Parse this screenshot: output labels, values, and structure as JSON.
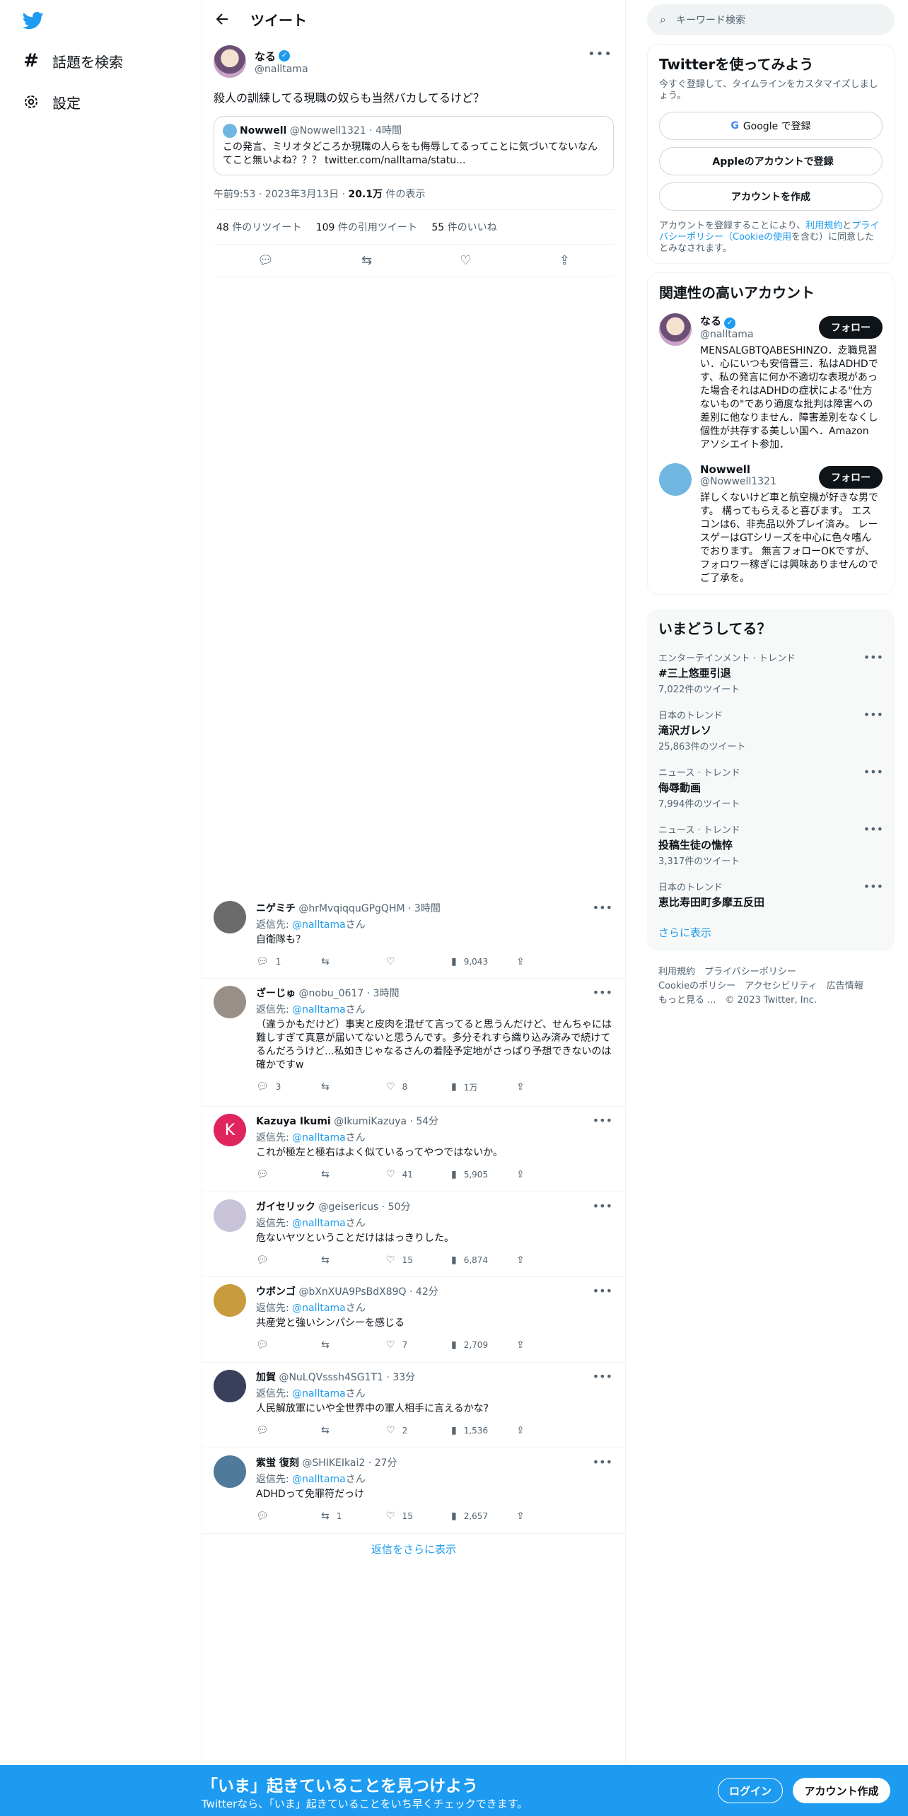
{
  "nav": {
    "explore": "話題を検索",
    "settings": "設定"
  },
  "header": {
    "title": "ツイート"
  },
  "tweet": {
    "name": "なる",
    "handle": "@nalltama",
    "text": "殺人の訓練してる現職の奴らも当然バカしてるけど？",
    "quote": {
      "name": "Nowwell",
      "handle": "@Nowwell1321",
      "time": "4時間",
      "text": "この発言、ミリオタどころか現職の人らをも侮辱してるってことに気づいてないなんてこと無いよね？？？ twitter.com/nalltama/statu..."
    },
    "time": "午前9:53 · 2023年3月13日 · ",
    "views_count": "20.1万",
    "views_label": " 件の表示",
    "retweets_count": "48",
    "retweets_label": " 件のリツイート",
    "quotes_count": "109",
    "quotes_label": " 件の引用ツイート",
    "likes_count": "55",
    "likes_label": " 件のいいね"
  },
  "reply_prefix": "返信先: ",
  "reply_suffix": "さん",
  "reply_target": "@nalltama",
  "replies": [
    {
      "name": "ニゲミチ",
      "handle": "@hrMvqiqquGPgQHM",
      "time": "3時間",
      "text": "自衛隊も？",
      "reply": "1",
      "retweet": "",
      "like": "",
      "views": "9,043",
      "color": "#6b6b6b"
    },
    {
      "name": "ざーじゅ",
      "handle": "@nobu_0617",
      "time": "3時間",
      "text": "（違うかもだけど）事実と皮肉を混ぜて言ってると思うんだけど、せんちゃには難しすぎて真意が届いてないと思うんです。多分それすら織り込み済みで続けてるんだろうけど...私如きじゃなるさんの着陸予定地がさっぱり予想できないのは確かですw",
      "reply": "3",
      "retweet": "",
      "like": "8",
      "views": "1万",
      "color": "#9a8f86"
    },
    {
      "name": "Kazuya Ikumi",
      "handle": "@IkumiKazuya",
      "time": "54分",
      "text": "これが極左と極右はよく似ているってやつではないか。",
      "reply": "",
      "retweet": "",
      "like": "41",
      "views": "5,905",
      "color": "#e0245e",
      "initial": "K"
    },
    {
      "name": "ガイセリック",
      "handle": "@geisericus",
      "time": "50分",
      "text": "危ないヤツということだけははっきりした。",
      "reply": "",
      "retweet": "",
      "like": "15",
      "views": "6,874",
      "color": "#c8c3d9"
    },
    {
      "name": "ウボンゴ",
      "handle": "@bXnXUA9PsBdX89Q",
      "time": "42分",
      "text": "共産党と強いシンパシーを感じる",
      "reply": "",
      "retweet": "",
      "like": "7",
      "views": "2,709",
      "color": "#c89b3c"
    },
    {
      "name": "加賀",
      "handle": "@NuLQVsssh4SG1T1",
      "time": "33分",
      "text": "人民解放軍にいや全世界中の軍人相手に言えるかな?",
      "reply": "",
      "retweet": "",
      "like": "2",
      "views": "1,536",
      "color": "#3a3f5c"
    },
    {
      "name": "紫蛍 復刻",
      "handle": "@SHIKEIkai2",
      "time": "27分",
      "text": "ADHDって免罪符だっけ",
      "reply": "",
      "retweet": "1",
      "like": "15",
      "views": "2,657",
      "color": "#4f7a9a"
    }
  ],
  "show_more_replies": "返信をさらに表示",
  "search": {
    "placeholder": "キーワード検索"
  },
  "signup": {
    "title": "Twitterを使ってみよう",
    "subtitle": "今すぐ登録して、タイムラインをカスタマイズしましょう。",
    "google": "Google で登録",
    "apple": "Appleのアカウントで登録",
    "create": "アカウントを作成",
    "legal_1": "アカウントを登録することにより、",
    "legal_terms": "利用規約",
    "legal_2": "と",
    "legal_privacy": "プライバシーポリシー（Cookieの使用",
    "legal_3": "を含む）に同意したとみなされます。"
  },
  "related": {
    "title": "関連性の高いアカウント",
    "follow": "フォロー",
    "accounts": [
      {
        "name": "なる",
        "handle": "@nalltama",
        "bio": "MENSALGBTQABESHINZO．赱職見習い．心にいつも安倍晋三．私はADHDです、私の発言に何か不適切な表現があった場合それはADHDの症状による\"仕方ないもの\"であり適度な批判は障害への差別に他なりません．障害差別をなくし個性が共存する美しい国へ．Amazonアソシエイト参加．"
      },
      {
        "name": "Nowwell",
        "handle": "@Nowwell1321",
        "bio": "詳しくないけど車と航空機が好きな男です。 構ってもらえると喜びます。 エスコンは6、非売品以外プレイ済み。 レースゲーはGTシリーズを中心に色々嗜んでおります。 無言フォローOKですが、フォロワー稼ぎには興味ありませんのでご了承を。"
      }
    ]
  },
  "trends": {
    "title": "いまどうしてる？",
    "items": [
      {
        "category": "エンターテインメント · トレンド",
        "name": "#三上悠亜引退",
        "count": "7,022件のツイート"
      },
      {
        "category": "日本のトレンド",
        "name": "滝沢ガレソ",
        "count": "25,863件のツイート"
      },
      {
        "category": "ニュース · トレンド",
        "name": "侮辱動画",
        "count": "7,994件のツイート"
      },
      {
        "category": "ニュース · トレンド",
        "name": "投稿生徒の憔悴",
        "count": "3,317件のツイート"
      },
      {
        "category": "日本のトレンド",
        "name": "恵比寿田町多摩五反田",
        "count": ""
      }
    ],
    "show_more": "さらに表示"
  },
  "footer": {
    "l1": "利用規約　プライバシーポリシー",
    "l2": "Cookieのポリシー　アクセシビリティ　広告情報",
    "l3": "もっと見る ...　© 2023 Twitter, Inc."
  },
  "bottom": {
    "title": "「いま」起きていることを見つけよう",
    "subtitle": "Twitterなら、「いま」起きていることをいち早くチェックできます。",
    "login": "ログイン",
    "signup": "アカウント作成"
  },
  "colors": {
    "accent": "#1d9bf0",
    "text": "#0f1419",
    "muted": "#536471"
  }
}
